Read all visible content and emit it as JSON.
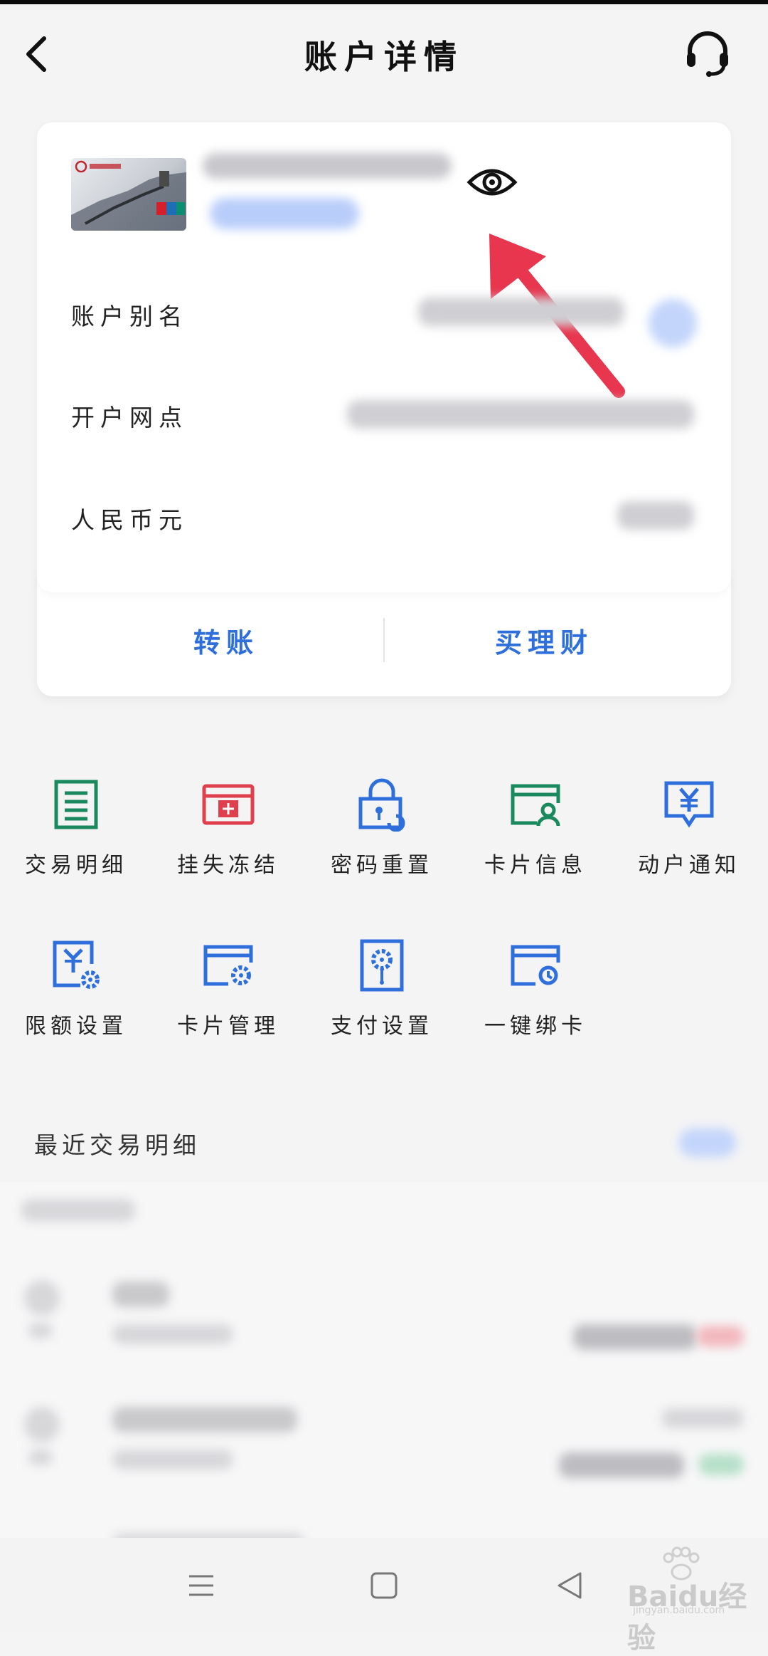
{
  "header": {
    "title": "账户详情",
    "back_icon": "chevron-left-icon",
    "service_icon": "headset-icon"
  },
  "account": {
    "eye_icon": "eye-icon",
    "rows": [
      {
        "label": "账户别名"
      },
      {
        "label": "开户网点"
      },
      {
        "label": "人民币元"
      }
    ],
    "actions": [
      {
        "label": "转账"
      },
      {
        "label": "买理财"
      }
    ]
  },
  "functions": [
    {
      "label": "交易明细",
      "icon": "transaction-list-icon",
      "color": "#1a8a5e"
    },
    {
      "label": "挂失冻结",
      "icon": "report-loss-icon",
      "color": "#e0404e"
    },
    {
      "label": "密码重置",
      "icon": "lock-reset-icon",
      "color": "#2f6fdc"
    },
    {
      "label": "卡片信息",
      "icon": "card-user-icon",
      "color": "#1a8a5e"
    },
    {
      "label": "动户通知",
      "icon": "yuan-notice-icon",
      "color": "#2f6fdc"
    },
    {
      "label": "限额设置",
      "icon": "limit-settings-icon",
      "color": "#2f6fdc"
    },
    {
      "label": "卡片管理",
      "icon": "card-settings-icon",
      "color": "#2f6fdc"
    },
    {
      "label": "支付设置",
      "icon": "payment-settings-icon",
      "color": "#2f6fdc"
    },
    {
      "label": "一键绑卡",
      "icon": "bind-card-icon",
      "color": "#2f6fdc"
    }
  ],
  "recent": {
    "title": "最近交易明细"
  },
  "colors": {
    "accent": "#2f6fdc",
    "arrow": "#e8364f"
  },
  "watermark": {
    "text": "Baidu经验",
    "sub": "jingyan.baidu.com"
  }
}
